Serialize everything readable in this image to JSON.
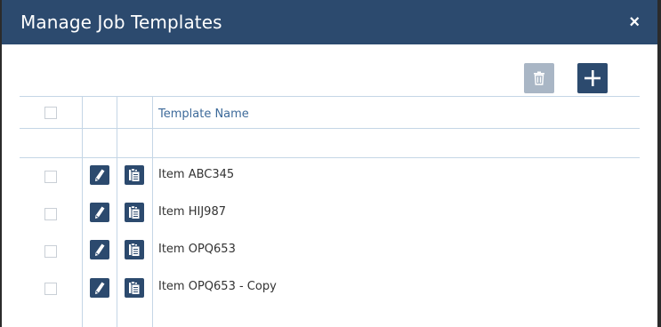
{
  "dialog": {
    "title": "Manage Job Templates",
    "close_icon": "×"
  },
  "toolbar": {
    "delete_icon": "trash-icon",
    "add_icon": "plus-icon"
  },
  "table": {
    "columns": [
      "",
      "",
      "",
      "Template Name"
    ],
    "rows": [
      {
        "name": "Item ABC345"
      },
      {
        "name": "Item HIJ987"
      },
      {
        "name": "Item OPQ653"
      },
      {
        "name": "Item OPQ653 - Copy"
      }
    ]
  },
  "colors": {
    "header_bg": "#2c4a6e",
    "accent": "#3d6a9a",
    "disabled_button": "#a9b6c5",
    "grid_line": "#c5d6e6"
  }
}
